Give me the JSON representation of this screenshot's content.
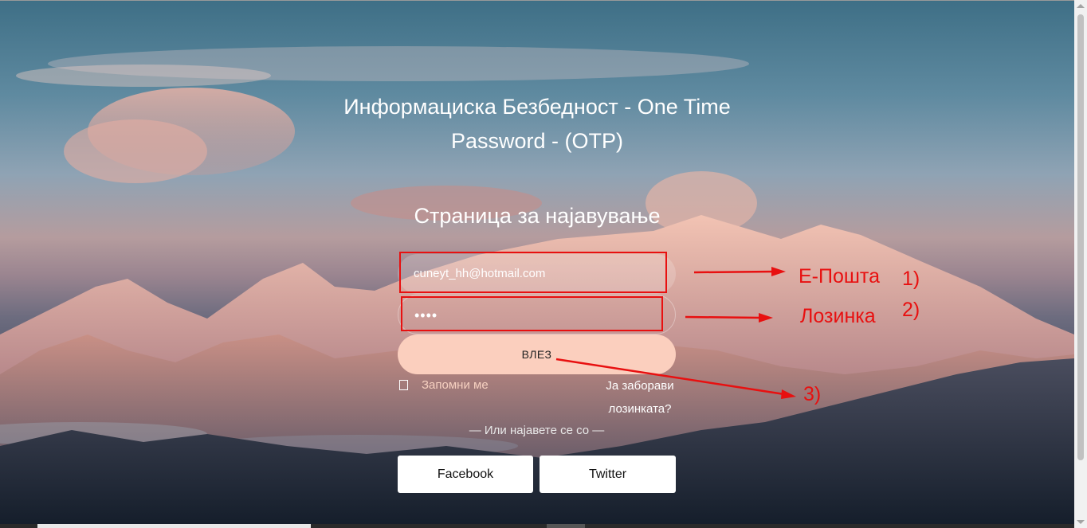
{
  "page": {
    "title": "Информациска Безбедност - One Time Password - (OTP)",
    "subtitle": "Страница за најавување"
  },
  "login_form": {
    "email_value": "cuneyt_hh@hotmail.com",
    "password_value": "••••",
    "login_button": "ВЛЕЗ",
    "remember_me": "Запомни ме",
    "forgot_password": "Ја заборави лозинката?",
    "or_login_with": "— Или најавете се со —",
    "facebook_button": "Facebook",
    "twitter_button": "Twitter"
  },
  "annotations": {
    "email_label": "Е-Пошта",
    "email_number": "1)",
    "password_label": "Лозинка",
    "password_number": "2)",
    "login_number": "3)",
    "color": "#e81010"
  },
  "colors": {
    "login_button": "#fbcfbe",
    "remember_text": "#f6d0c0",
    "social_buttons": "#ffffff"
  }
}
